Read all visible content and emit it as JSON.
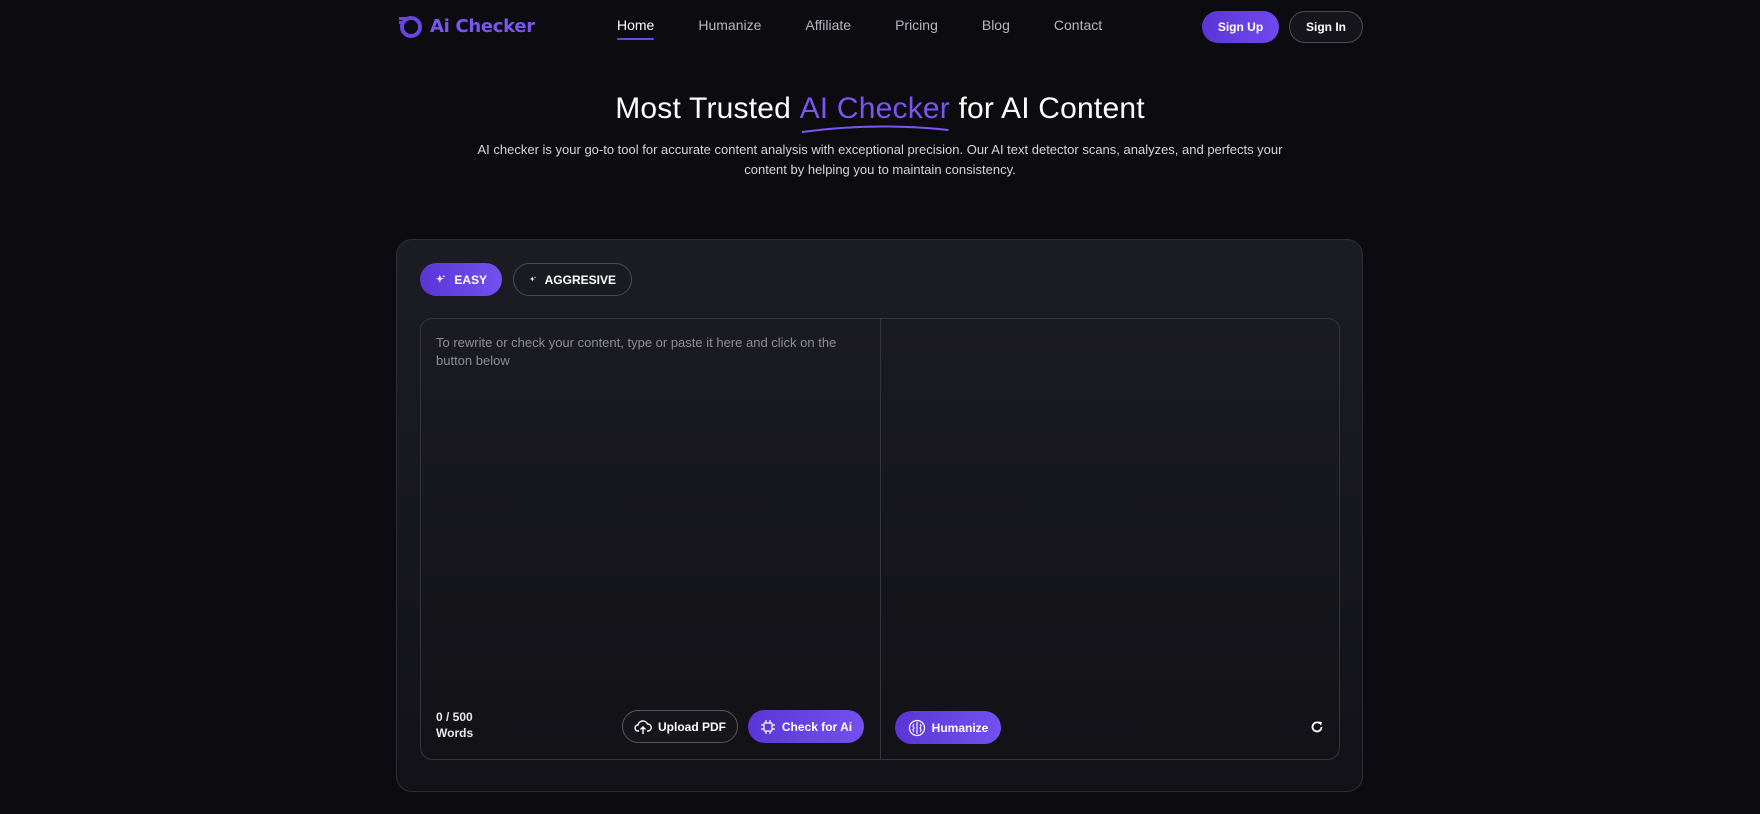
{
  "brand": {
    "name": "Ai Checker",
    "accent": "#7b55f0"
  },
  "nav": {
    "links": [
      {
        "label": "Home",
        "active": true
      },
      {
        "label": "Humanize"
      },
      {
        "label": "Affiliate"
      },
      {
        "label": "Pricing"
      },
      {
        "label": "Blog"
      },
      {
        "label": "Contact"
      }
    ],
    "signup_label": "Sign Up",
    "signin_label": "Sign In"
  },
  "hero": {
    "title_before": "Most Trusted ",
    "title_accent": "AI Checker",
    "title_after": " for AI Content",
    "subtitle": "AI checker is your go-to tool for accurate content analysis with exceptional precision. Our AI text detector scans, analyzes, and perfects your content by helping you to maintain consistency."
  },
  "modes": {
    "easy_label": "EASY",
    "aggressive_label": "AGGRESIVE",
    "selected": "EASY"
  },
  "editor": {
    "placeholder": "To rewrite or check your content, type or paste it here and click on the button below",
    "word_count": "0 / 500",
    "word_unit": "Words",
    "upload_label": "Upload PDF",
    "check_label": "Check for Ai",
    "humanize_label": "Humanize",
    "icons": [
      "sparkle-icon",
      "cloud-upload-icon",
      "chip-icon",
      "brain-icon",
      "refresh-icon"
    ]
  }
}
